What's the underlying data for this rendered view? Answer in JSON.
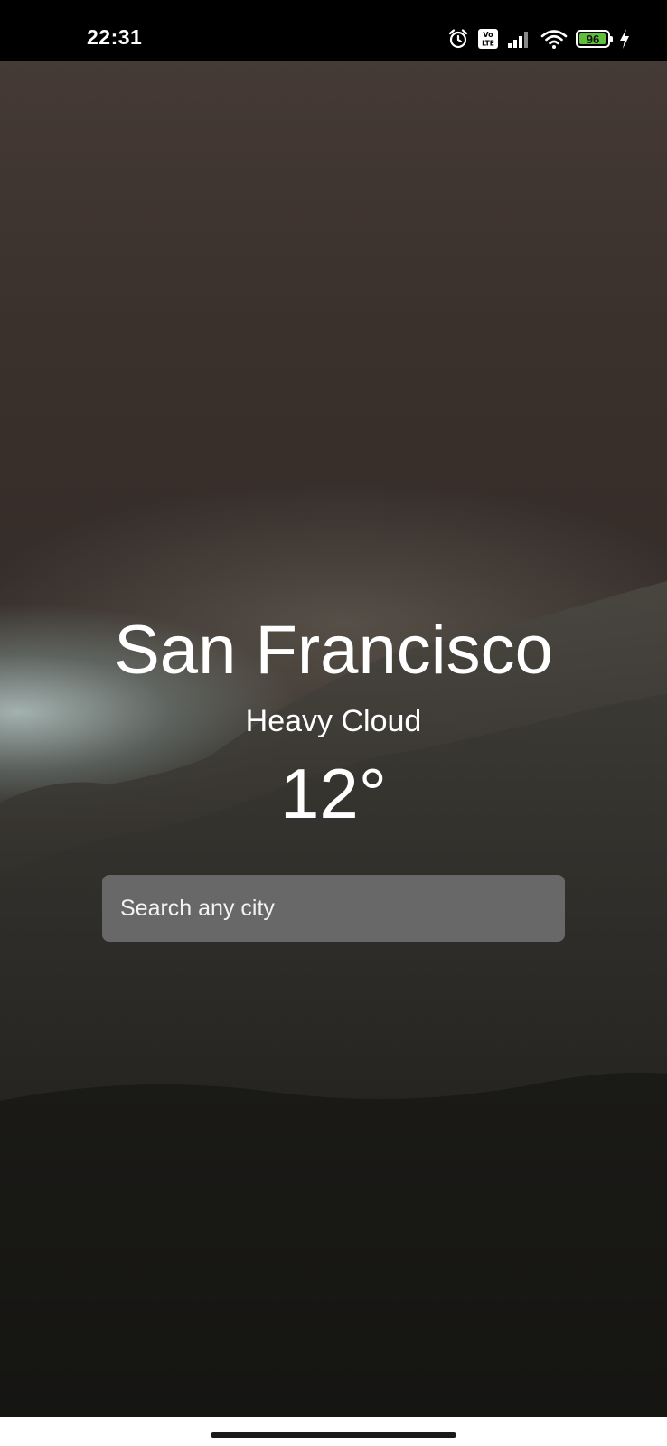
{
  "status_bar": {
    "time": "22:31",
    "battery_level": "96",
    "battery_fraction": 0.96,
    "icons": [
      "alarm-icon",
      "volte-icon",
      "signal-icon",
      "wifi-icon",
      "battery-icon",
      "charging-icon"
    ]
  },
  "weather": {
    "city": "San Francisco",
    "condition": "Heavy Cloud",
    "temperature": "12°"
  },
  "search": {
    "placeholder": "Search any city",
    "value": ""
  },
  "colors": {
    "text": "#ffffff",
    "search_background": "#6e6e6e",
    "battery_fill": "#5fbf3b",
    "status_bar": "#000000",
    "nav_bar": "#ffffff"
  }
}
